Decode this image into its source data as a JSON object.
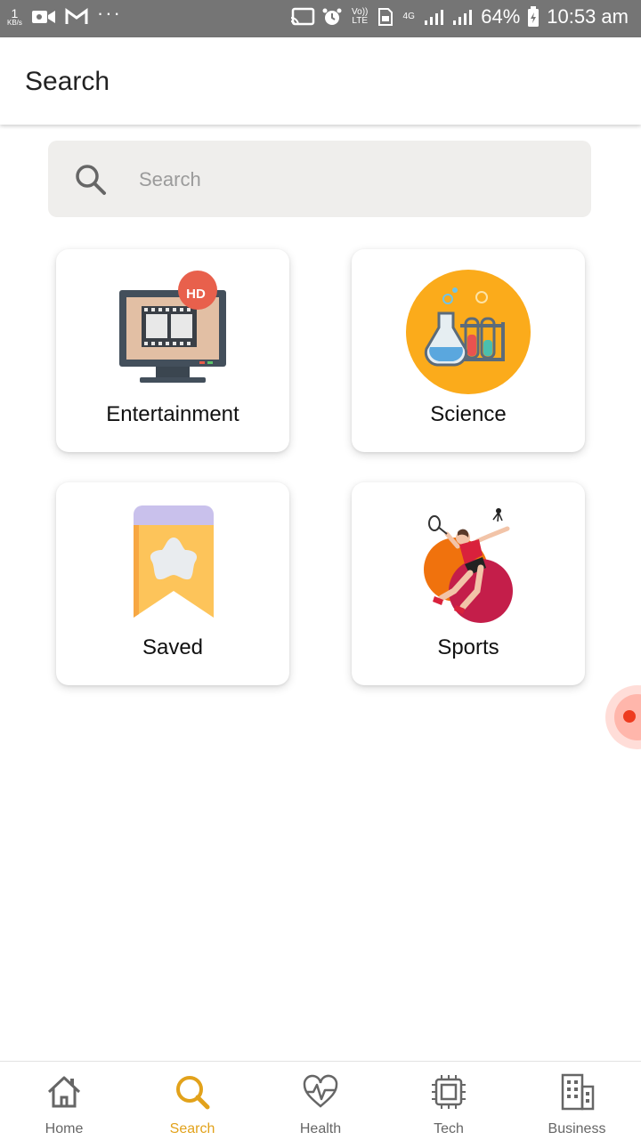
{
  "status_bar": {
    "net_speed": "1",
    "net_unit": "KB/s",
    "more": "···",
    "volte": "Vo)) LTE",
    "network": "4G",
    "battery": "64%",
    "time": "10:53 am"
  },
  "header": {
    "title": "Search"
  },
  "search": {
    "placeholder": "Search",
    "value": ""
  },
  "categories": [
    {
      "label": "Entertainment",
      "icon": "hd-monitor-icon",
      "badge": "HD"
    },
    {
      "label": "Science",
      "icon": "lab-flasks-icon"
    },
    {
      "label": "Saved",
      "icon": "bookmark-star-icon"
    },
    {
      "label": "Sports",
      "icon": "badminton-player-icon"
    }
  ],
  "bottom_nav": [
    {
      "label": "Home",
      "icon": "home-icon"
    },
    {
      "label": "Search",
      "icon": "search-icon",
      "active": true
    },
    {
      "label": "Health",
      "icon": "heart-pulse-icon"
    },
    {
      "label": "Tech",
      "icon": "chip-icon"
    },
    {
      "label": "Business",
      "icon": "building-icon"
    }
  ],
  "colors": {
    "accent": "#e2a21b",
    "status_bar": "#757575",
    "search_bg": "#efeeec"
  }
}
